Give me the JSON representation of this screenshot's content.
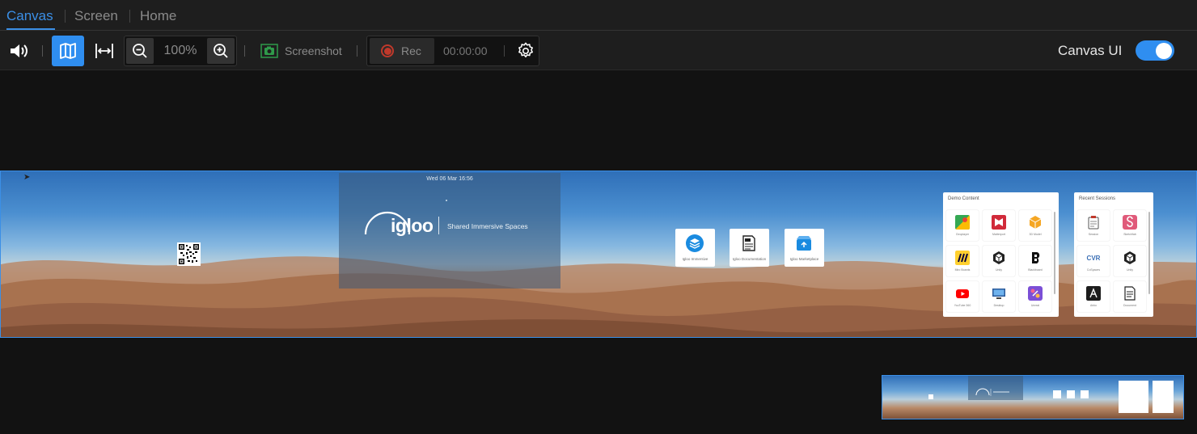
{
  "tabs": [
    {
      "label": "Canvas",
      "active": true
    },
    {
      "label": "Screen",
      "active": false
    },
    {
      "label": "Home",
      "active": false
    }
  ],
  "toolbar": {
    "zoom_value": "100%",
    "screenshot_label": "Screenshot",
    "rec_label": "Rec",
    "rec_time": "00:00:00",
    "canvas_ui_label": "Canvas UI",
    "canvas_ui_enabled": true
  },
  "canvas": {
    "datetime": "Wed 06 Mar 16:56",
    "logo_text": "igloo",
    "tagline": "Shared Immersive Spaces",
    "apps": [
      {
        "label": "Igloo Immersive",
        "icon": "layers-icon"
      },
      {
        "label": "Igloo Documentation",
        "icon": "document-icon"
      },
      {
        "label": "Igloo Marketplace",
        "icon": "store-icon"
      }
    ],
    "demo_content": {
      "title": "Demo Content",
      "items": [
        {
          "label": "Geoplayer",
          "icon": "map-pin-icon"
        },
        {
          "label": "Matterport",
          "icon": "matterport-icon"
        },
        {
          "label": "3D Model",
          "icon": "cube-icon"
        },
        {
          "label": "Miro Boards",
          "icon": "miro-icon"
        },
        {
          "label": "Unity",
          "icon": "unity-icon"
        },
        {
          "label": "Blackboard",
          "icon": "blackboard-icon"
        },
        {
          "label": "YouTube 360",
          "icon": "youtube-icon"
        },
        {
          "label": "Desktop",
          "icon": "desktop-icon"
        },
        {
          "label": "Unreal",
          "icon": "unreal-icon"
        }
      ]
    },
    "recent_sessions": {
      "title": "Recent Sessions",
      "items": [
        {
          "label": "Session",
          "icon": "clipboard-icon"
        },
        {
          "label": "Sketchfab",
          "icon": "sketchfab-icon"
        },
        {
          "label": "CoSpaces",
          "icon": "cvr-icon"
        },
        {
          "label": "Unity",
          "icon": "unity-icon"
        },
        {
          "label": "Arkio",
          "icon": "arkio-icon"
        },
        {
          "label": "Document",
          "icon": "document-icon"
        }
      ]
    }
  },
  "colors": {
    "accent": "#2f8ef0",
    "background": "#121212",
    "toolbar": "#1e1e1e",
    "rec": "#c0392b"
  }
}
